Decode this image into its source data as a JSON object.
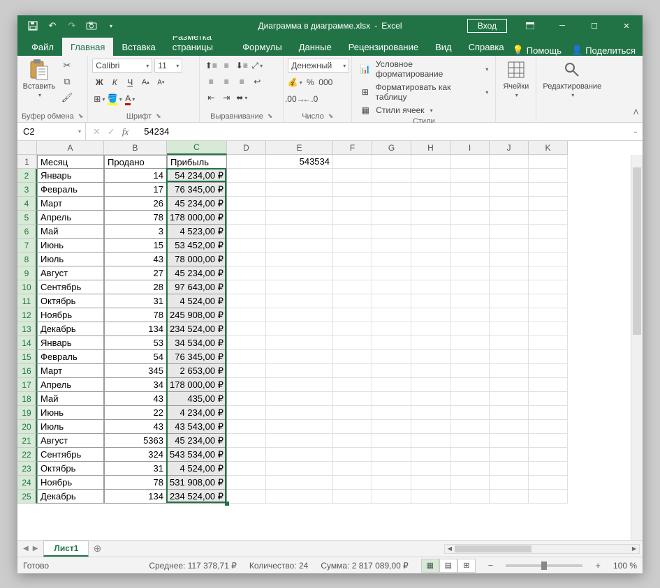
{
  "title": {
    "filename": "Диаграмма в диаграмме.xlsx",
    "app": "Excel"
  },
  "qat": {
    "save": "💾",
    "undo": "↶",
    "redo": "↷",
    "camera": "📷"
  },
  "login": "Вход",
  "tabs": {
    "file": "Файл",
    "home": "Главная",
    "insert": "Вставка",
    "layout": "Разметка страницы",
    "formulas": "Формулы",
    "data": "Данные",
    "review": "Рецензирование",
    "view": "Вид",
    "help": "Справка",
    "tell": "Помощь",
    "share": "Поделиться"
  },
  "ribbon": {
    "clipboard": {
      "paste": "Вставить",
      "label": "Буфер обмена"
    },
    "font": {
      "name": "Calibri",
      "size": "11",
      "label": "Шрифт",
      "bold": "Ж",
      "italic": "К",
      "underline": "Ч"
    },
    "alignment": {
      "label": "Выравнивание"
    },
    "number": {
      "format": "Денежный",
      "label": "Число"
    },
    "styles": {
      "conditional": "Условное форматирование",
      "table": "Форматировать как таблицу",
      "cell": "Стили ячеек",
      "label": "Стили"
    },
    "cells": {
      "label": "Ячейки"
    },
    "editing": {
      "label": "Редактирование"
    }
  },
  "formulabar": {
    "namebox": "C2",
    "value": "54234",
    "fx": "fx"
  },
  "columns": [
    {
      "id": "A",
      "w": 96
    },
    {
      "id": "B",
      "w": 90
    },
    {
      "id": "C",
      "w": 86
    },
    {
      "id": "D",
      "w": 56
    },
    {
      "id": "E",
      "w": 96
    },
    {
      "id": "F",
      "w": 56
    },
    {
      "id": "G",
      "w": 56
    },
    {
      "id": "H",
      "w": 56
    },
    {
      "id": "I",
      "w": 56
    },
    {
      "id": "J",
      "w": 56
    },
    {
      "id": "K",
      "w": 56
    }
  ],
  "selected_col": "C",
  "active_cell": {
    "row": 2,
    "col": "C"
  },
  "selection": {
    "col": "C",
    "row_start": 2,
    "row_end": 25
  },
  "headers": {
    "A": "Месяц",
    "B": "Продано",
    "C": "Прибыль"
  },
  "e1": "543534",
  "rows": [
    {
      "n": 2,
      "a": "Январь",
      "b": "14",
      "c": "54 234,00 ₽"
    },
    {
      "n": 3,
      "a": "Февраль",
      "b": "17",
      "c": "76 345,00 ₽"
    },
    {
      "n": 4,
      "a": "Март",
      "b": "26",
      "c": "45 234,00 ₽"
    },
    {
      "n": 5,
      "a": "Апрель",
      "b": "78",
      "c": "178 000,00 ₽"
    },
    {
      "n": 6,
      "a": "Май",
      "b": "3",
      "c": "4 523,00 ₽"
    },
    {
      "n": 7,
      "a": "Июнь",
      "b": "15",
      "c": "53 452,00 ₽"
    },
    {
      "n": 8,
      "a": "Июль",
      "b": "43",
      "c": "78 000,00 ₽"
    },
    {
      "n": 9,
      "a": "Август",
      "b": "27",
      "c": "45 234,00 ₽"
    },
    {
      "n": 10,
      "a": "Сентябрь",
      "b": "28",
      "c": "97 643,00 ₽"
    },
    {
      "n": 11,
      "a": "Октябрь",
      "b": "31",
      "c": "4 524,00 ₽"
    },
    {
      "n": 12,
      "a": "Ноябрь",
      "b": "78",
      "c": "245 908,00 ₽"
    },
    {
      "n": 13,
      "a": "Декабрь",
      "b": "134",
      "c": "234 524,00 ₽"
    },
    {
      "n": 14,
      "a": "Январь",
      "b": "53",
      "c": "34 534,00 ₽"
    },
    {
      "n": 15,
      "a": "Февраль",
      "b": "54",
      "c": "76 345,00 ₽"
    },
    {
      "n": 16,
      "a": "Март",
      "b": "345",
      "c": "2 653,00 ₽"
    },
    {
      "n": 17,
      "a": "Апрель",
      "b": "34",
      "c": "178 000,00 ₽"
    },
    {
      "n": 18,
      "a": "Май",
      "b": "43",
      "c": "435,00 ₽"
    },
    {
      "n": 19,
      "a": "Июнь",
      "b": "22",
      "c": "4 234,00 ₽"
    },
    {
      "n": 20,
      "a": "Июль",
      "b": "43",
      "c": "43 543,00 ₽"
    },
    {
      "n": 21,
      "a": "Август",
      "b": "5363",
      "c": "45 234,00 ₽"
    },
    {
      "n": 22,
      "a": "Сентябрь",
      "b": "324",
      "c": "543 534,00 ₽"
    },
    {
      "n": 23,
      "a": "Октябрь",
      "b": "31",
      "c": "4 524,00 ₽"
    },
    {
      "n": 24,
      "a": "Ноябрь",
      "b": "78",
      "c": "531 908,00 ₽"
    },
    {
      "n": 25,
      "a": "Декабрь",
      "b": "134",
      "c": "234 524,00 ₽"
    }
  ],
  "sheet": {
    "name": "Лист1"
  },
  "status": {
    "ready": "Готово",
    "average_label": "Среднее:",
    "average": "117 378,71 ₽",
    "count_label": "Количество:",
    "count": "24",
    "sum_label": "Сумма:",
    "sum": "2 817 089,00 ₽",
    "zoom": "100 %"
  }
}
